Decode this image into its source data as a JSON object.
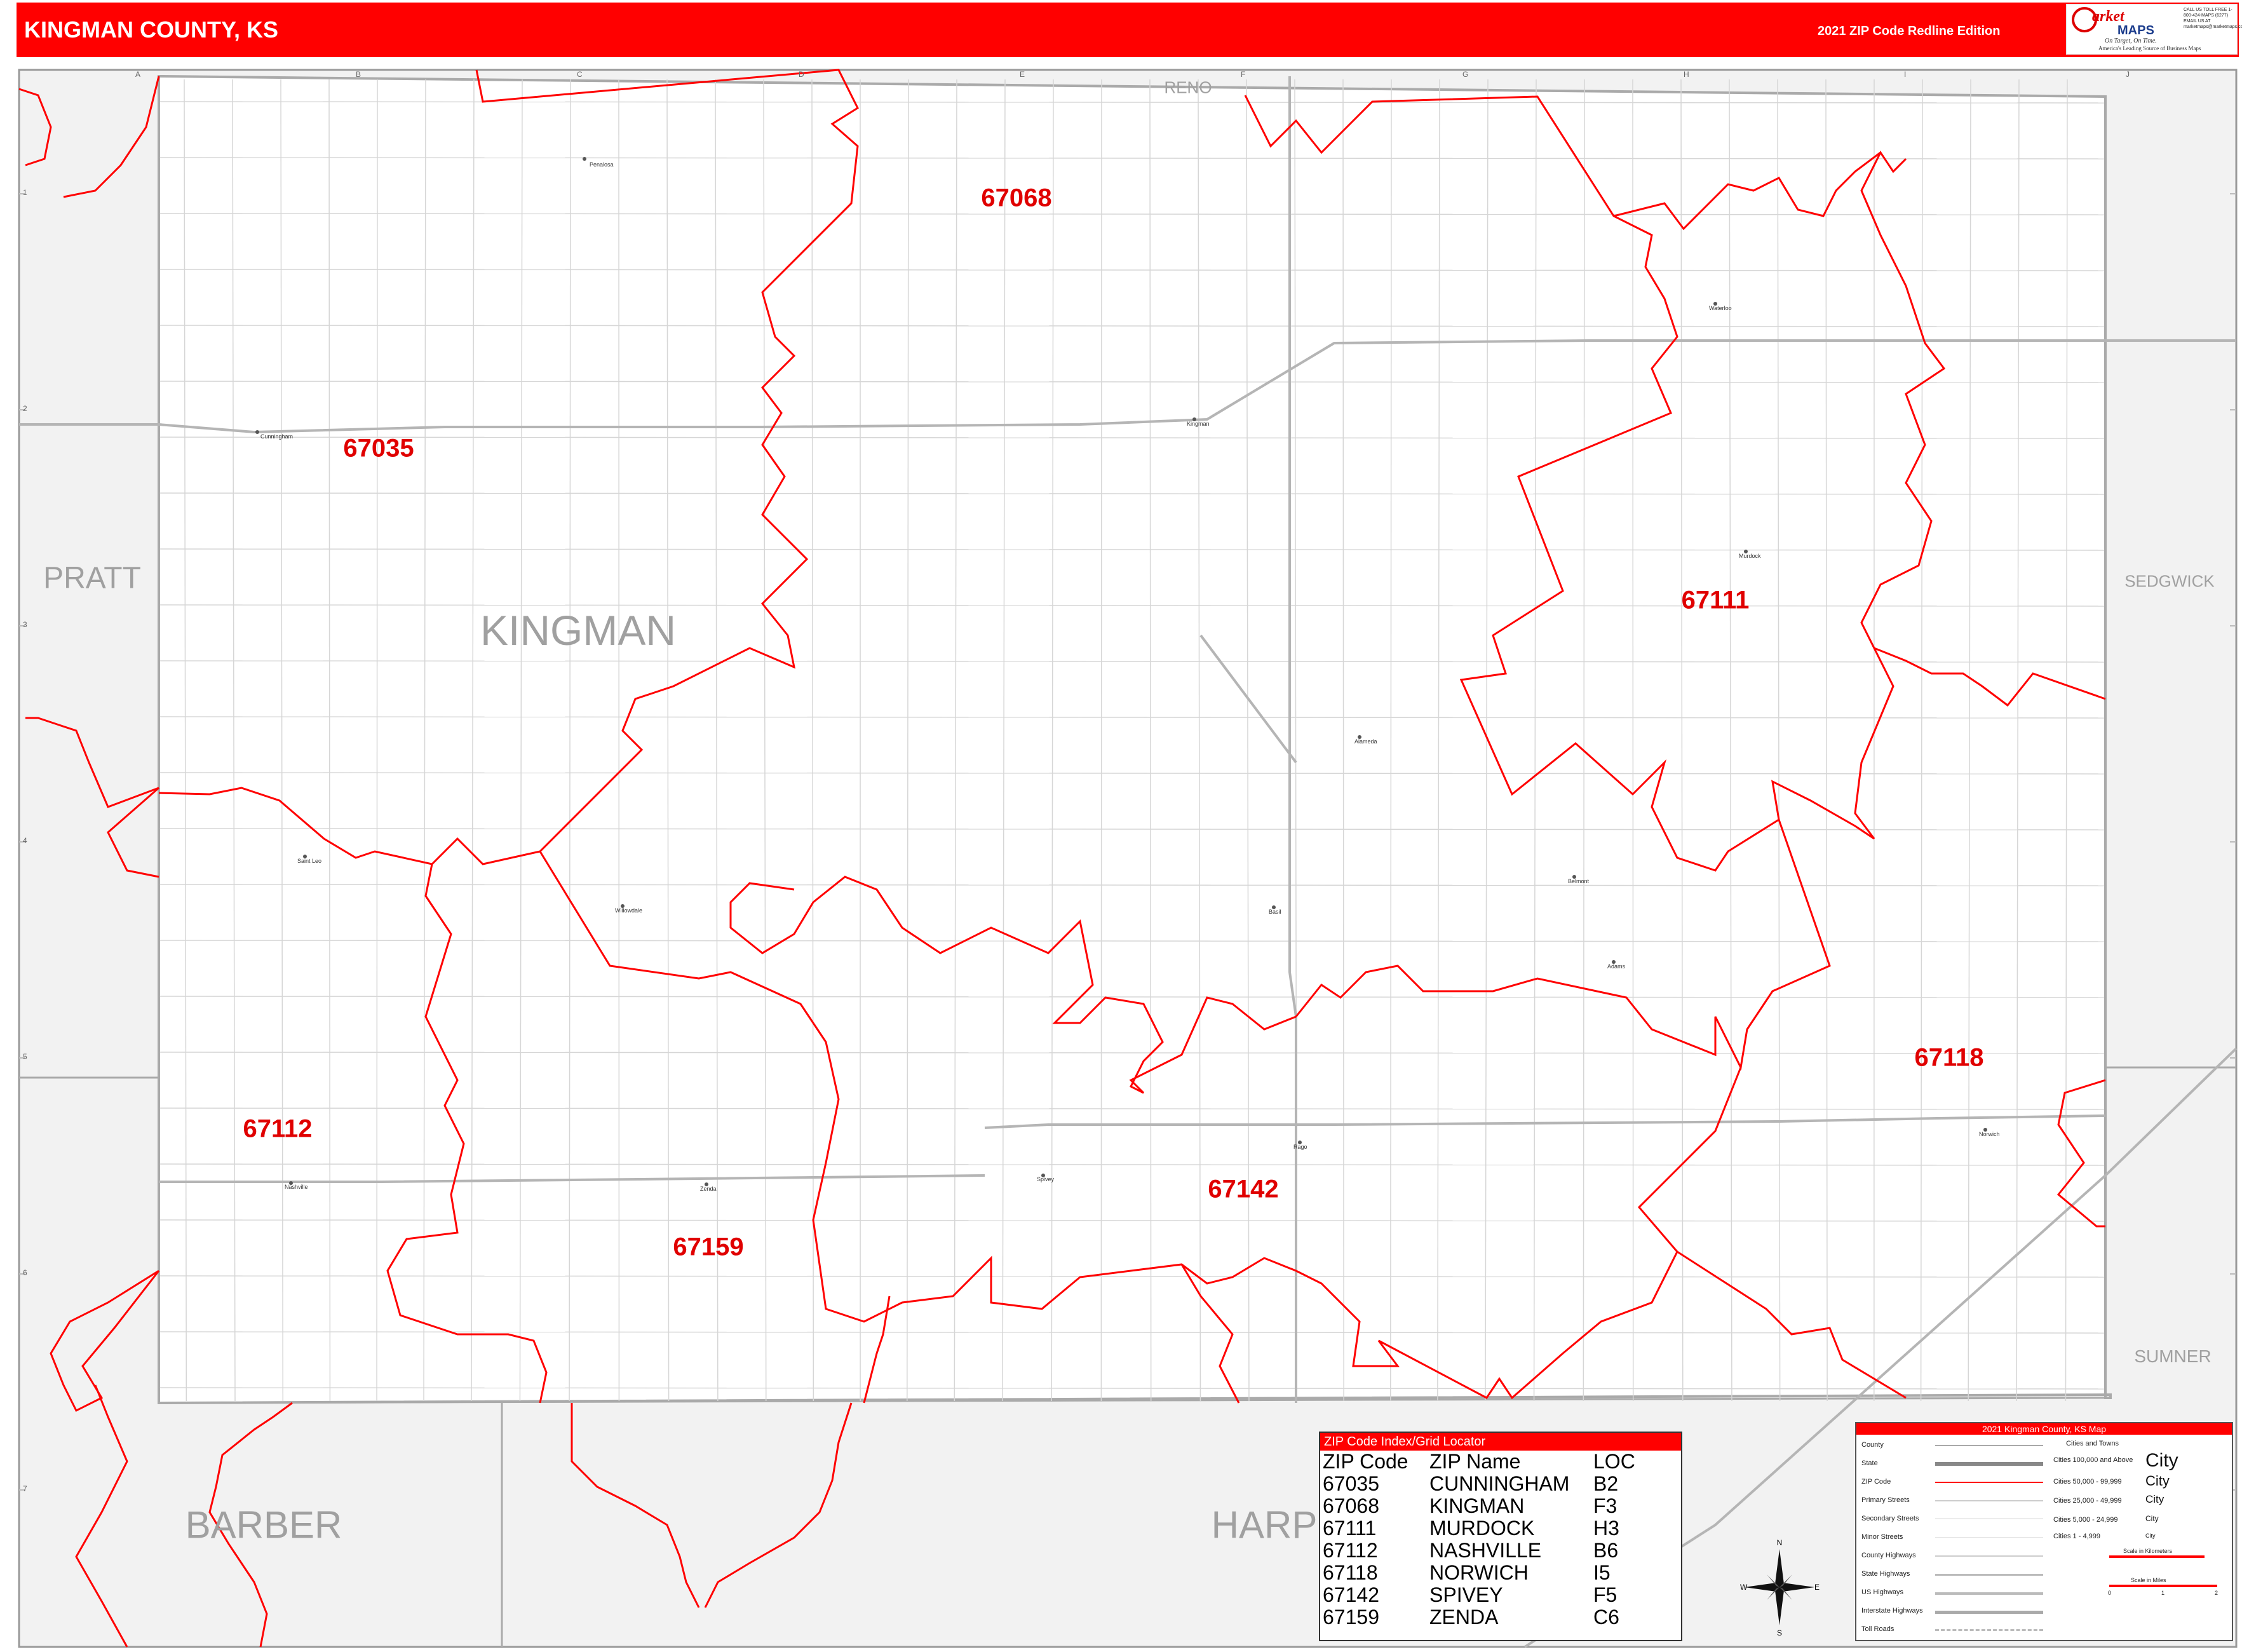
{
  "header": {
    "title": "KINGMAN COUNTY, KS",
    "edition": "2021 ZIP Code Redline Edition"
  },
  "logo": {
    "brand_top": "arket",
    "brand_bottom": "MAPS",
    "tagline": "On Target, On Time.",
    "tagline2": "America's Leading Source of Business Maps",
    "contact": "CALL US TOLL FREE 1-800-424-MAPS (6277) EMAIL US AT marketmaps@marketmaps.com"
  },
  "counties": {
    "main": "KINGMAN",
    "reno": "RENO",
    "pratt": "PRATT",
    "sedgwick": "SEDGWICK",
    "sumner": "SUMNER",
    "barber": "BARBER",
    "harper": "HARP"
  },
  "zip_labels": [
    {
      "zip": "67068"
    },
    {
      "zip": "67035"
    },
    {
      "zip": "67111"
    },
    {
      "zip": "67118"
    },
    {
      "zip": "67112"
    },
    {
      "zip": "67142"
    },
    {
      "zip": "67159"
    }
  ],
  "towns": [
    "Penalosa",
    "Cunningham",
    "Kingman",
    "Waterloo",
    "Murdock",
    "Alameda",
    "Saint Leo",
    "Willowdale",
    "Basil",
    "Belmont",
    "Adams",
    "Nashville",
    "Zenda",
    "Spivey",
    "Rago",
    "Norwich"
  ],
  "grid": {
    "columns": [
      "A",
      "B",
      "C",
      "D",
      "E",
      "F",
      "G",
      "H",
      "I",
      "J"
    ],
    "rows": [
      "1",
      "2",
      "3",
      "4",
      "5",
      "6",
      "7"
    ]
  },
  "zip_index": {
    "title": "ZIP Code Index/Grid Locator",
    "headers": [
      "ZIP Code",
      "ZIP Name",
      "LOC"
    ],
    "rows": [
      [
        "67035",
        "CUNNINGHAM",
        "B2"
      ],
      [
        "67068",
        "KINGMAN",
        "F3"
      ],
      [
        "67111",
        "MURDOCK",
        "H3"
      ],
      [
        "67112",
        "NASHVILLE",
        "B6"
      ],
      [
        "67118",
        "NORWICH",
        "I5"
      ],
      [
        "67142",
        "SPIVEY",
        "F5"
      ],
      [
        "67159",
        "ZENDA",
        "C6"
      ]
    ]
  },
  "legend": {
    "title": "2021 Kingman County, KS Map",
    "items": [
      "County",
      "State",
      "ZIP Code",
      "Primary Streets",
      "Secondary Streets",
      "Minor Streets",
      "County Highways",
      "State Highways",
      "US Highways",
      "Interstate Highways",
      "Toll Roads"
    ],
    "cities_heading": "Cities and Towns",
    "cities": [
      {
        "label": "Cities 100,000 and Above",
        "sample": "City"
      },
      {
        "label": "Cities 50,000 - 99,999",
        "sample": "City"
      },
      {
        "label": "Cities 25,000 - 49,999",
        "sample": "City"
      },
      {
        "label": "Cities 5,000 - 24,999",
        "sample": "City"
      },
      {
        "label": "Cities 1 - 4,999",
        "sample": "City"
      }
    ],
    "scale_km": "Scale in Kilometers",
    "scale_mi": "Scale in Miles",
    "scale_ticks_mi": [
      "0",
      "1",
      "2"
    ]
  },
  "compass": {
    "n": "N",
    "s": "S",
    "e": "E",
    "w": "W"
  },
  "colors": {
    "header": "#ff0000",
    "zip_boundary": "#ff0000",
    "zip_label": "#e00000",
    "outside_county": "#f2f2f2",
    "road": "#bdbdbd"
  }
}
